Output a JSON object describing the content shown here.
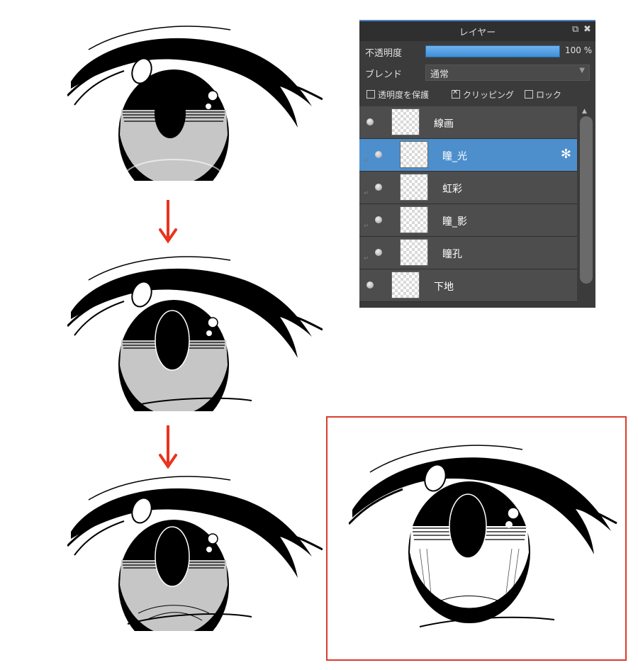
{
  "panel": {
    "title": "レイヤー",
    "icons": {
      "detach": "detach-icon",
      "close": "close-icon"
    },
    "opacity": {
      "label": "不透明度",
      "value_text": "100 %",
      "fill": 1.0
    },
    "blend": {
      "label": "ブレンド",
      "value": "通常"
    },
    "options": [
      {
        "label": "透明度を保護",
        "checked": false
      },
      {
        "label": "クリッピング",
        "checked": true
      },
      {
        "label": "ロック",
        "checked": false
      }
    ],
    "layers": [
      {
        "name": "線画",
        "clipped": false,
        "selected": false
      },
      {
        "name": "瞳_光",
        "clipped": true,
        "selected": true
      },
      {
        "name": "虹彩",
        "clipped": true,
        "selected": false
      },
      {
        "name": "瞳_影",
        "clipped": true,
        "selected": false
      },
      {
        "name": "瞳孔",
        "clipped": true,
        "selected": false
      },
      {
        "name": "下地",
        "clipped": false,
        "selected": false
      }
    ]
  },
  "colors": {
    "accent": "#4d8fcc",
    "arrow": "#e8331e",
    "frame": "#d93d2b",
    "iris_gray": "#c6c6c6"
  }
}
